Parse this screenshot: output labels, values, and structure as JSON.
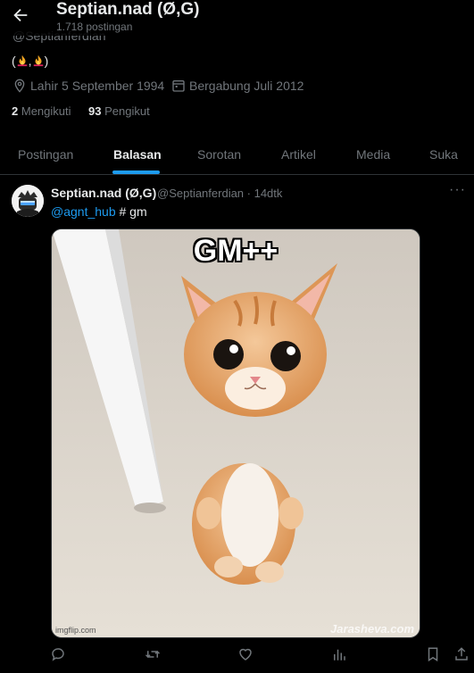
{
  "header": {
    "display_name": "Septian.nad (Ø,G)",
    "post_count": "1.718 postingan"
  },
  "profile": {
    "handle": "@Septianferdian",
    "bio_open": "(",
    "bio_sep": ",",
    "bio_close": ")",
    "birth": "Lahir 5 September 1994",
    "joined": "Bergabung Juli 2012",
    "following_count": "2",
    "following_label": "Mengikuti",
    "followers_count": "93",
    "followers_label": "Pengikut"
  },
  "tabs": [
    {
      "label": "Postingan"
    },
    {
      "label": "Balasan"
    },
    {
      "label": "Sorotan"
    },
    {
      "label": "Artikel"
    },
    {
      "label": "Media"
    },
    {
      "label": "Suka"
    }
  ],
  "post": {
    "author": "Septian.nad (Ø,G)",
    "meta": "@Septianferdian · 14dtk",
    "mention": "@agnt_hub",
    "text": " # gm",
    "more": "···",
    "image": {
      "caption_top": "GM++",
      "source": "imgflip.com",
      "watermark": "Jarasheva.com"
    }
  },
  "icons": {
    "back": "arrow-left-icon",
    "location": "location-pin-icon",
    "calendar": "calendar-icon",
    "reply": "reply-icon",
    "repost": "repost-icon",
    "like": "heart-icon",
    "views": "views-icon",
    "bookmark": "bookmark-icon",
    "share": "share-icon"
  },
  "colors": {
    "accent": "#1d9bf0",
    "background": "#000000",
    "muted": "#71767b",
    "text": "#e7e9ea"
  }
}
